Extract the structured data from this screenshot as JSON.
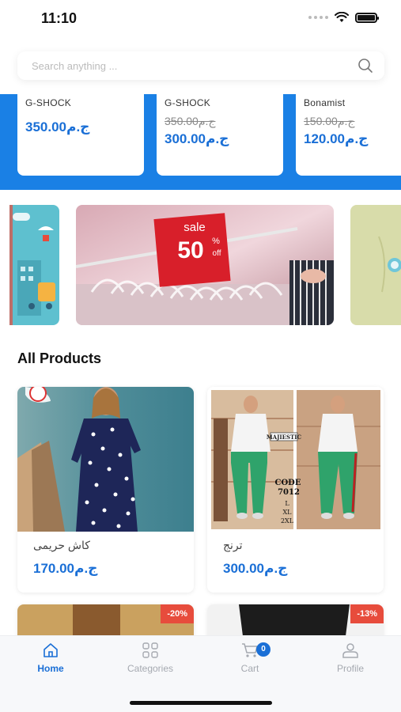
{
  "status": {
    "time": "11:10"
  },
  "search": {
    "placeholder": "Search anything ..."
  },
  "deals": [
    {
      "brand": "G-SHOCK",
      "price": "350.00ج.م"
    },
    {
      "brand": "G-SHOCK",
      "old_price": "350.00ج.م",
      "price": "300.00ج.م"
    },
    {
      "brand": "Bonamist",
      "old_price": "150.00ج.م",
      "price": "120.00ج.م"
    }
  ],
  "banner": {
    "sale_text": "sale",
    "percent": "50",
    "percent_sign": "%",
    "off": "off"
  },
  "all_products": {
    "title": "All Products",
    "items": [
      {
        "name": "كاش حريمى",
        "price": "170.00ج.م"
      },
      {
        "name": "ترنج",
        "price": "300.00ج.م",
        "img_text": {
          "brand": "MAJIESTIC",
          "code": "CODE",
          "num": "7012",
          "s1": "L",
          "s2": "XL",
          "s3": "2XL"
        }
      },
      {
        "badge": "-20%"
      },
      {
        "badge": "-13%"
      }
    ]
  },
  "nav": {
    "items": [
      {
        "label": "Home",
        "icon": "home-icon",
        "active": true
      },
      {
        "label": "Categories",
        "icon": "grid-icon"
      },
      {
        "label": "Cart",
        "icon": "cart-icon",
        "badge": "0"
      },
      {
        "label": "Profile",
        "icon": "user-icon"
      }
    ]
  },
  "colors": {
    "accent": "#1a80e5",
    "price": "#1a6fd6",
    "discount": "#e74c3c"
  }
}
